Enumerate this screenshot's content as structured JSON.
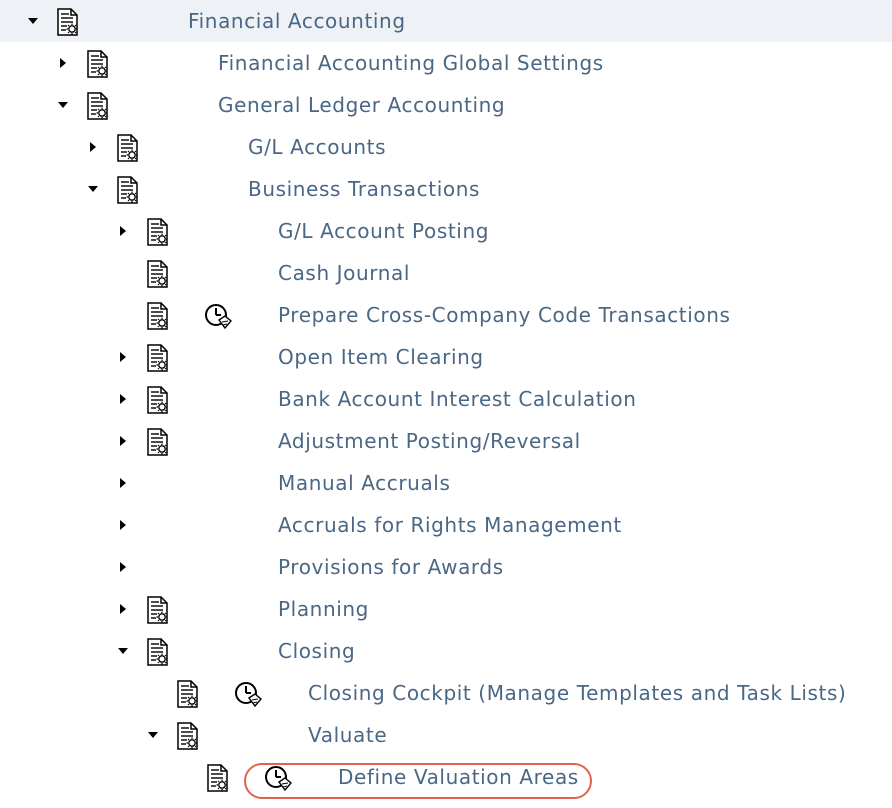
{
  "tree": {
    "root": "Financial Accounting",
    "global_settings": "Financial Accounting Global Settings",
    "gl_accounting": "General Ledger Accounting",
    "gl_accounts": "G/L Accounts",
    "business_transactions": "Business Transactions",
    "gl_account_posting": "G/L Account Posting",
    "cash_journal": "Cash Journal",
    "cross_company": "Prepare Cross-Company Code Transactions",
    "open_item_clearing": "Open Item Clearing",
    "bank_interest": "Bank Account Interest Calculation",
    "adjustment_posting": "Adjustment Posting/Reversal",
    "manual_accruals": "Manual Accruals",
    "accruals_rights": "Accruals for Rights Management",
    "provisions_awards": "Provisions for Awards",
    "planning": "Planning",
    "closing": "Closing",
    "closing_cockpit": "Closing Cockpit (Manage Templates and Task Lists)",
    "valuate": "Valuate",
    "define_valuation_areas": "Define Valuation Areas"
  },
  "colors": {
    "label_text": "#4a6785",
    "root_highlight": "#eef2f6",
    "annotation_outline": "#e0644c"
  },
  "icons": {
    "expanded": "triangle-down-icon",
    "collapsed": "triangle-right-icon",
    "document": "documentation-icon",
    "execute": "clock-execute-icon"
  }
}
